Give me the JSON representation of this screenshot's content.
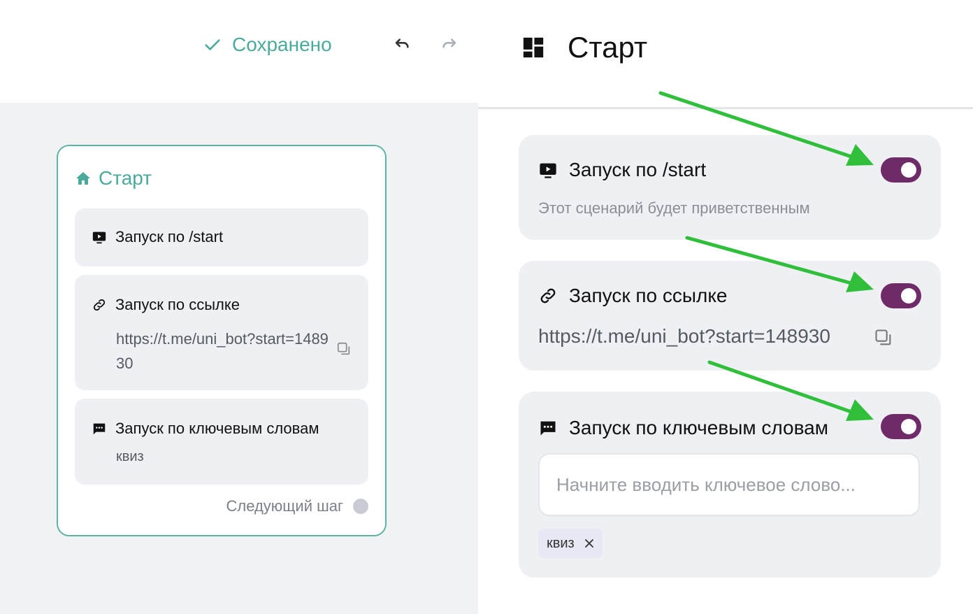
{
  "toolbar": {
    "saved_label": "Сохранено",
    "accent_color": "#4aab9b"
  },
  "node": {
    "title": "Старт",
    "cards": [
      {
        "title": "Запуск по /start"
      },
      {
        "title": "Запуск по ссылке",
        "link": "https://t.me/uni_bot?start=148930"
      },
      {
        "title": "Запуск по ключевым словам",
        "keyword": "квиз"
      }
    ],
    "next_step_label": "Следующий шаг"
  },
  "panel": {
    "title": "Старт",
    "cards": [
      {
        "title": "Запуск по /start",
        "description": "Этот сценарий будет приветственным",
        "enabled": true
      },
      {
        "title": "Запуск по ссылке",
        "link": "https://t.me/uni_bot?start=148930",
        "enabled": true
      },
      {
        "title": "Запуск по ключевым словам",
        "input_placeholder": "Начните вводить ключевое слово...",
        "chips": [
          "квиз"
        ],
        "enabled": true
      }
    ],
    "toggle_color": "#6e2b67",
    "annotation_arrow_color": "#2fbf3a"
  }
}
